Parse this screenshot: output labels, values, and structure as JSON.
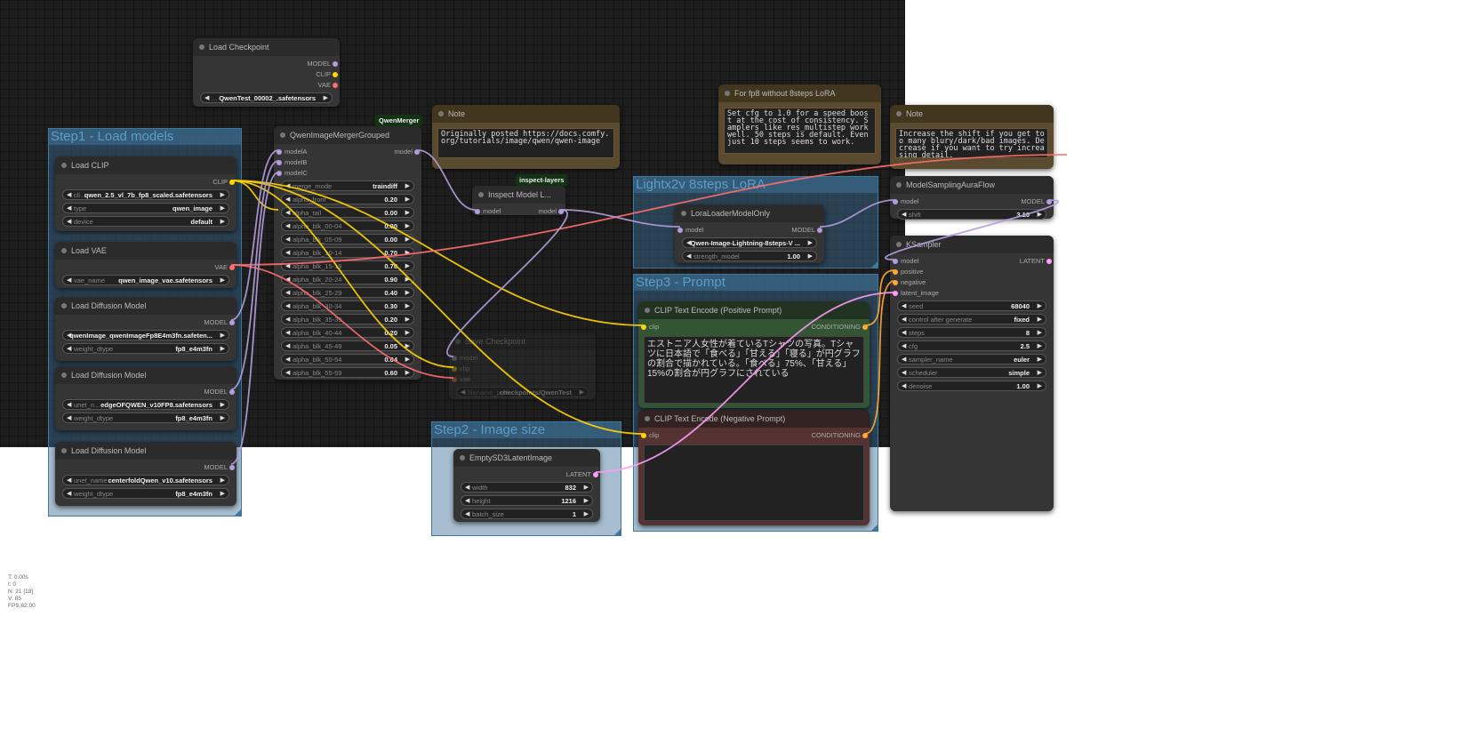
{
  "slot_colors": {
    "MODEL": "#b39ddb",
    "CLIP": "#ffd500",
    "VAE": "#ff6e6e",
    "LATENT": "#ff9cf9",
    "CONDITIONING": "#ffa931"
  },
  "groups": [
    {
      "id": "g1",
      "title": "Step1 - Load models"
    },
    {
      "id": "g2",
      "title": "Step2 - Image size"
    },
    {
      "id": "g3",
      "title": "Step3 - Prompt"
    },
    {
      "id": "g4",
      "title": "Lightx2v 8steps LoRA"
    }
  ],
  "badges": [
    {
      "id": "b1",
      "text": "QwenMerger"
    },
    {
      "id": "b2",
      "text": "inspect-layers"
    }
  ],
  "nodes": [
    {
      "id": "ckpt",
      "title": "Load Checkpoint",
      "inputs": [],
      "outputs": [
        [
          "MODEL",
          "MODEL"
        ],
        [
          "CLIP",
          "CLIP"
        ],
        [
          "VAE",
          "VAE"
        ]
      ],
      "widgets": [
        [
          "...",
          "QwenTest_00002_.safetensors"
        ]
      ]
    },
    {
      "id": "clip",
      "title": "Load CLIP",
      "inputs": [],
      "outputs": [
        [
          "CLIP",
          "CLIP"
        ]
      ],
      "widgets": [
        [
          "cli...",
          "qwen_2.5_vl_7b_fp8_scaled.safetensors"
        ],
        [
          "type",
          "qwen_image"
        ],
        [
          "device",
          "default"
        ]
      ]
    },
    {
      "id": "vae",
      "title": "Load VAE",
      "inputs": [],
      "outputs": [
        [
          "VAE",
          "VAE"
        ]
      ],
      "widgets": [
        [
          "vae_name",
          "qwen_image_vae.safetensors"
        ]
      ]
    },
    {
      "id": "ldm1",
      "title": "Load Diffusion Model",
      "inputs": [],
      "outputs": [
        [
          "MODEL",
          "MODEL"
        ]
      ],
      "widgets": [
        [
          "",
          "qwenImage_qwenImageFp8E4m3fn.safeten..."
        ],
        [
          "weight_dtype",
          "fp8_e4m3fn"
        ]
      ]
    },
    {
      "id": "ldm2",
      "title": "Load Diffusion Model",
      "inputs": [],
      "outputs": [
        [
          "MODEL",
          "MODEL"
        ]
      ],
      "widgets": [
        [
          "unet_n...",
          "edgeOFQWEN_v10FP8.safetensors"
        ],
        [
          "weight_dtype",
          "fp8_e4m3fn"
        ]
      ]
    },
    {
      "id": "ldm3",
      "title": "Load Diffusion Model",
      "inputs": [],
      "outputs": [
        [
          "MODEL",
          "MODEL"
        ]
      ],
      "widgets": [
        [
          "unet_name",
          "centerfoldQwen_v10.safetensors"
        ],
        [
          "weight_dtype",
          "fp8_e4m3fn"
        ]
      ]
    },
    {
      "id": "merger",
      "title": "QwenImageMergerGrouped",
      "inputs": [
        [
          "modelA",
          "MODEL"
        ],
        [
          "modelB",
          "MODEL"
        ],
        [
          "modelC",
          "MODEL"
        ]
      ],
      "outputs": [
        [
          "model",
          "MODEL"
        ]
      ],
      "widgets": [
        [
          "merge_mode",
          "traindiff"
        ],
        [
          "alpha_front",
          "0.20"
        ],
        [
          "alpha_tail",
          "0.00"
        ],
        [
          "alpha_blk_00-04",
          "0.00"
        ],
        [
          "alpha_blk_05-09",
          "0.00"
        ],
        [
          "alpha_blk_10-14",
          "0.70"
        ],
        [
          "alpha_blk_15-19",
          "0.70"
        ],
        [
          "alpha_blk_20-24",
          "0.90"
        ],
        [
          "alpha_blk_25-29",
          "0.40"
        ],
        [
          "alpha_blk_30-34",
          "0.30"
        ],
        [
          "alpha_blk_35-39",
          "0.20"
        ],
        [
          "alpha_blk_40-44",
          "0.20"
        ],
        [
          "alpha_blk_45-49",
          "0.05"
        ],
        [
          "alpha_blk_50-54",
          "0.04"
        ],
        [
          "alpha_blk_55-59",
          "0.60"
        ]
      ]
    },
    {
      "id": "note1",
      "title": "Note",
      "note": "Originally posted https://docs.comfy.org/tutorials/image/qwen/qwen-image"
    },
    {
      "id": "inspect",
      "title": "Inspect Model L...",
      "inputs": [
        [
          "model",
          "MODEL"
        ]
      ],
      "outputs": [
        [
          "model",
          "MODEL"
        ]
      ],
      "widgets": []
    },
    {
      "id": "save",
      "title": "Save Checkpoint",
      "inputs": [
        [
          "model",
          "MODEL"
        ],
        [
          "clip",
          "CLIP"
        ],
        [
          "vae",
          "VAE"
        ]
      ],
      "outputs": [],
      "widgets": [
        [
          "filename_prefix",
          "checkpoints/QwenTest"
        ]
      ]
    },
    {
      "id": "lora",
      "title": "LoraLoaderModelOnly",
      "inputs": [
        [
          "model",
          "MODEL"
        ]
      ],
      "outputs": [
        [
          "MODEL",
          "MODEL"
        ]
      ],
      "widgets": [
        [
          "",
          "Qwen-Image-Lightning-8steps-V ..."
        ],
        [
          "strength_model",
          "1.00"
        ]
      ]
    },
    {
      "id": "notefp8",
      "title": "For fp8 without 8steps LoRA",
      "note": "Set cfg to 1.0 for a speed boost at the cost of consistency. Samplers like res_multistep work well. 50 steps is default. Even just 10 steps seems to work."
    },
    {
      "id": "note2",
      "title": "Note",
      "note": "Increase the shift if you get too many blury/dark/bad images. Decrease if you want to try increasing detail."
    },
    {
      "id": "aura",
      "title": "ModelSamplingAuraFlow",
      "inputs": [
        [
          "model",
          "MODEL"
        ]
      ],
      "outputs": [
        [
          "MODEL",
          "MODEL"
        ]
      ],
      "widgets": [
        [
          "shift",
          "3.10"
        ]
      ]
    },
    {
      "id": "ks",
      "title": "KSampler",
      "inputs": [
        [
          "model",
          "MODEL"
        ],
        [
          "positive",
          "CONDITIONING"
        ],
        [
          "negative",
          "CONDITIONING"
        ],
        [
          "latent_image",
          "LATENT"
        ]
      ],
      "outputs": [
        [
          "LATENT",
          "LATENT"
        ]
      ],
      "widgets": [
        [
          "seed",
          "68040"
        ],
        [
          "control after generate",
          "fixed"
        ],
        [
          "steps",
          "8"
        ],
        [
          "cfg",
          "2.5"
        ],
        [
          "sampler_name",
          "euler"
        ],
        [
          "scheduler",
          "simple"
        ],
        [
          "denoise",
          "1.00"
        ]
      ]
    },
    {
      "id": "pos",
      "title": "CLIP Text Encode (Positive Prompt)",
      "inputs": [
        [
          "clip",
          "CLIP"
        ]
      ],
      "outputs": [
        [
          "CONDITIONING",
          "CONDITIONING"
        ]
      ],
      "text": "エストニア人女性が着ているTシャツの写真。Tシャツに日本語で「食べる」「甘える」「寝る」が円グラフの割合で描かれている。「食べる」75%、「甘える」15%の割合が円グラフにされている"
    },
    {
      "id": "neg",
      "title": "CLIP Text Encode (Negative Prompt)",
      "inputs": [
        [
          "clip",
          "CLIP"
        ]
      ],
      "outputs": [
        [
          "CONDITIONING",
          "CONDITIONING"
        ]
      ],
      "text": ""
    },
    {
      "id": "latent",
      "title": "EmptySD3LatentImage",
      "inputs": [],
      "outputs": [
        [
          "LATENT",
          "LATENT"
        ]
      ],
      "widgets": [
        [
          "width",
          "832"
        ],
        [
          "height",
          "1216"
        ],
        [
          "batch_size",
          "1"
        ]
      ]
    }
  ],
  "stats": [
    "T: 0.00s",
    "I: 0",
    "N: 21 [18]",
    "V: 85",
    "FPS:62.00"
  ]
}
